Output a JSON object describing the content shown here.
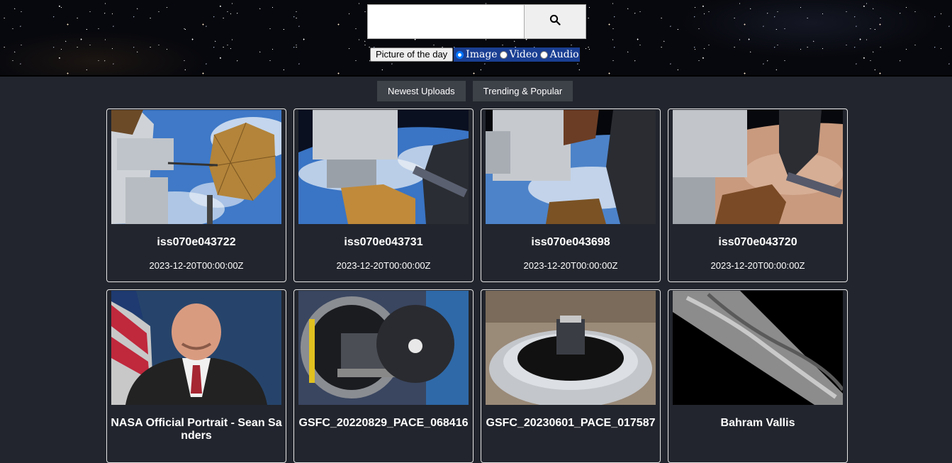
{
  "search": {
    "value": "",
    "placeholder": ""
  },
  "options": {
    "potd_label": "Picture of the day",
    "media_types": [
      {
        "label": "Image",
        "checked": true
      },
      {
        "label": "Video",
        "checked": false
      },
      {
        "label": "Audio",
        "checked": false
      }
    ]
  },
  "tabs": [
    {
      "label": "Newest Uploads"
    },
    {
      "label": "Trending & Popular"
    }
  ],
  "cards": [
    {
      "title": "iss070e043722",
      "date": "2023-12-20T00:00:00Z"
    },
    {
      "title": "iss070e043731",
      "date": "2023-12-20T00:00:00Z"
    },
    {
      "title": "iss070e043698",
      "date": "2023-12-20T00:00:00Z"
    },
    {
      "title": "iss070e043720",
      "date": "2023-12-20T00:00:00Z"
    },
    {
      "title": "NASA Official Portrait - Sean Sanders",
      "date": ""
    },
    {
      "title": "GSFC_20220829_PACE_068416",
      "date": ""
    },
    {
      "title": "GSFC_20230601_PACE_017587",
      "date": ""
    },
    {
      "title": "Bahram Vallis",
      "date": ""
    }
  ],
  "colors": {
    "page_bg": "#22252d",
    "tab_bg": "#3d4148",
    "radio_group_bg": "#1a3f93"
  }
}
